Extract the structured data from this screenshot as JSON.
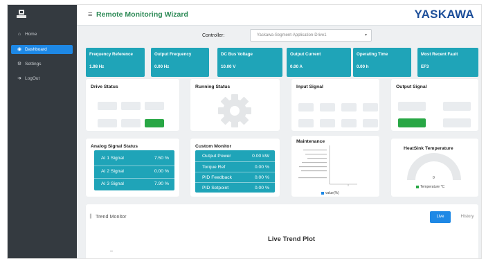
{
  "header": {
    "title": "Remote Monitoring Wizard",
    "brand": "YASKAWA"
  },
  "sidebar": {
    "items": [
      {
        "label": "Home",
        "icon": "home-icon",
        "active": false
      },
      {
        "label": "Dashboard",
        "icon": "dashboard-icon",
        "active": true
      },
      {
        "label": "Settings",
        "icon": "settings-icon",
        "active": false
      },
      {
        "label": "LogOut",
        "icon": "logout-icon",
        "active": false
      }
    ]
  },
  "controller": {
    "label": "Controller:",
    "selected": "Yaskawa-Segment-Application-Drive1"
  },
  "metrics": [
    {
      "label": "Frequency Reference",
      "value": "1.98 Hz"
    },
    {
      "label": "Output Frequency",
      "value": "0.00 Hz"
    },
    {
      "label": "DC Bus Voltage",
      "value": "10.00 V"
    },
    {
      "label": "Output Current",
      "value": "0.00 A"
    },
    {
      "label": "Operating Time",
      "value": "0.00 h"
    },
    {
      "label": "Most Recent Fault",
      "value": "EF3"
    }
  ],
  "panels": {
    "drive_status": "Drive Status",
    "running_status": "Running Status",
    "input_signal": "Input Signal",
    "output_signal": "Output Signal",
    "analog_signal_status": "Analog Signal Status",
    "custom_monitor": "Custom Monitor",
    "maintenance": "Maintenance",
    "heatsink_temperature": "HeatSink Temperature"
  },
  "analog_signals": [
    {
      "label": "AI 1 Signal",
      "value": "7.50 %"
    },
    {
      "label": "AI 2 Signal",
      "value": "0.00 %"
    },
    {
      "label": "AI 3 Signal",
      "value": "7.90 %"
    }
  ],
  "custom_monitor": [
    {
      "label": "Output Power",
      "value": "0.00 kW"
    },
    {
      "label": "Torque Ref",
      "value": "0.00 %"
    },
    {
      "label": "PID Feedback",
      "value": "0.00 %"
    },
    {
      "label": "PID Setpoint",
      "value": "0.00 %"
    }
  ],
  "maintenance_legend": "value(%)",
  "heatsink": {
    "value": "0",
    "legend": "Temperature °C"
  },
  "trend": {
    "title": "Trend Monitor",
    "live": "Live",
    "history": "History",
    "plot_title": "Live Trend Plot"
  },
  "colors": {
    "accent_teal": "#1fa4b8",
    "active_blue": "#1e88e5",
    "sidebar_bg": "#343a40",
    "title_green": "#2e8b57",
    "brand_blue": "#1d4f9a",
    "status_on": "#28a745"
  }
}
